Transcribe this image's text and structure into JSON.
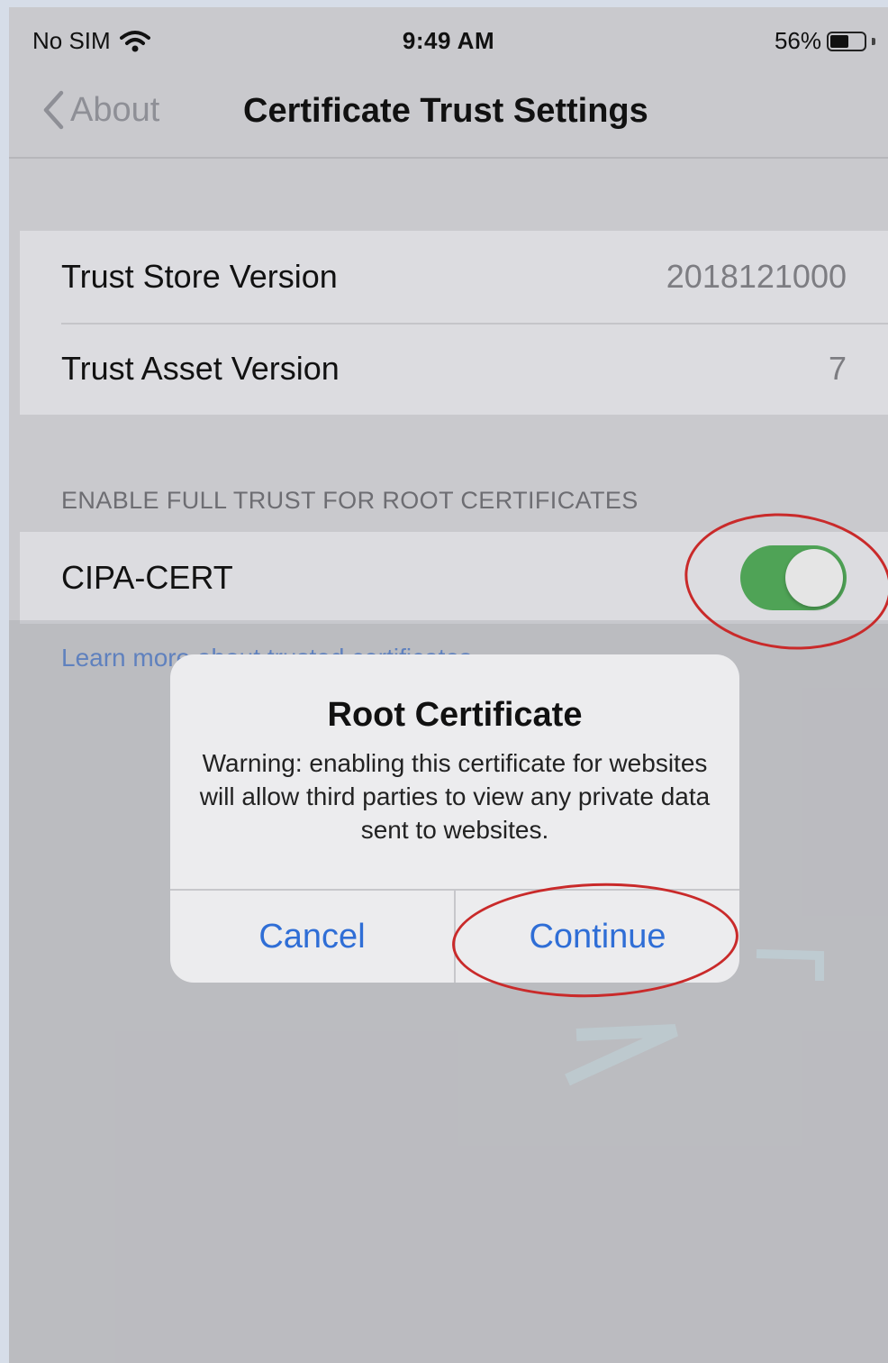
{
  "status_bar": {
    "carrier": "No SIM",
    "time": "9:49 AM",
    "battery_percent": "56%",
    "battery_level": 0.56,
    "wifi_icon": "wifi-icon",
    "battery_icon": "battery-icon"
  },
  "nav": {
    "back_label": "About",
    "title": "Certificate Trust Settings",
    "back_icon": "chevron-left-icon"
  },
  "trust_info": {
    "rows": [
      {
        "label": "Trust Store Version",
        "value": "2018121000"
      },
      {
        "label": "Trust Asset Version",
        "value": "7"
      }
    ]
  },
  "root_section": {
    "header": "ENABLE FULL TRUST FOR ROOT CERTIFICATES",
    "certificate_label": "CIPA-CERT",
    "toggle_on": true,
    "footer_link": "Learn more about trusted certificates"
  },
  "alert": {
    "title": "Root Certificate",
    "message": "Warning: enabling this certificate for websites will allow third parties to view any private data sent to websites.",
    "cancel_label": "Cancel",
    "continue_label": "Continue"
  },
  "colors": {
    "toggle_on": "#4fa356",
    "link_blue": "#2f6ed6",
    "annotation_red": "#c92a2a"
  }
}
